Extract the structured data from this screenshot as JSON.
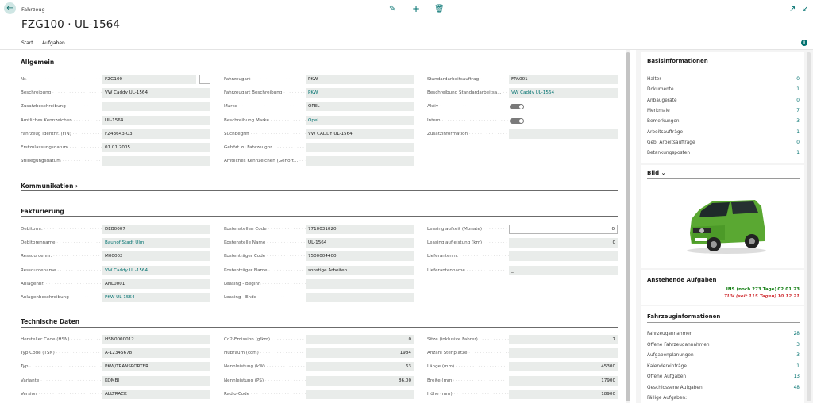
{
  "header": {
    "breadcrumb": "Fahrzeug",
    "title": "FZG100 · UL-1564",
    "icons": [
      "back-arrow-icon",
      "edit-icon",
      "plus-icon",
      "delete-icon",
      "open-new-icon",
      "collapse-icon"
    ]
  },
  "tabs": [
    "Start",
    "Aufgaben"
  ],
  "sections": {
    "allgemein": "Allgemein",
    "kommunikation": "Kommunikation",
    "fakturierung": "Fakturierung",
    "technische": "Technische Daten"
  },
  "allgemein": {
    "col1": [
      {
        "label": "Nr.",
        "value": "FZG100"
      },
      {
        "label": "Beschreibung",
        "value": "VW Caddy UL-1564"
      },
      {
        "label": "Zusatzbeschreibung",
        "value": ""
      },
      {
        "label": "Amtliches Kennzeichen",
        "value": "UL-1564"
      },
      {
        "label": "Fahrzeug Identnr. (FIN)",
        "value": "FZ43643-U3"
      },
      {
        "label": "Erstzulassungsdatum",
        "value": "01.01.2005"
      },
      {
        "label": "Stilllegungsdatum",
        "value": ""
      }
    ],
    "col2": [
      {
        "label": "Fahrzeugart",
        "value": "PKW"
      },
      {
        "label": "Fahrzeugart Beschreibung",
        "value": "PKW"
      },
      {
        "label": "Marke",
        "value": "OPEL"
      },
      {
        "label": "Beschreibung Marke",
        "value": "Opel"
      },
      {
        "label": "Suchbegriff",
        "value": "VW CADDY UL-1564"
      },
      {
        "label": "Gehört zu Fahrzeugnr.",
        "value": ""
      },
      {
        "label": "Amtliches Kennzeichen (Gehört...",
        "value": "_"
      }
    ],
    "col3": [
      {
        "label": "Standardarbeitsauftrag",
        "value": "FPA001"
      },
      {
        "label": "Beschreibung Standardarbeitsa...",
        "value": "VW Caddy UL-1564"
      },
      {
        "label": "Aktiv",
        "value": ""
      },
      {
        "label": "Intern",
        "value": ""
      },
      {
        "label": "Zusatzinformation",
        "value": ""
      }
    ],
    "more_button": "..."
  },
  "fakturierung": {
    "col1": [
      {
        "label": "Debitornr.",
        "value": "DEB0007"
      },
      {
        "label": "Debitorenname",
        "value": "Bauhof Stadt Ulm"
      },
      {
        "label": "Ressourcennr.",
        "value": "M00002"
      },
      {
        "label": "Ressourcename",
        "value": "VW Caddy UL-1564"
      },
      {
        "label": "Anlagennr.",
        "value": "ANL0001"
      },
      {
        "label": "Anlagenbeschreibung",
        "value": "PKW UL-1564"
      }
    ],
    "col2": [
      {
        "label": "Kostenstellen Code",
        "value": "7710031020"
      },
      {
        "label": "Kostenstelle Name",
        "value": "UL-1564"
      },
      {
        "label": "Kostenträger Code",
        "value": "7500004400"
      },
      {
        "label": "Kostenträger Name",
        "value": "sonstige Arbeiten"
      },
      {
        "label": "Leasing - Beginn",
        "value": ""
      },
      {
        "label": "Leasing - Ende",
        "value": ""
      }
    ],
    "col3": [
      {
        "label": "Leasinglaufzeit (Monate)",
        "value": "0"
      },
      {
        "label": "Leasinglaufleistung (km)",
        "value": "0"
      },
      {
        "label": "Lieferantennr.",
        "value": ""
      },
      {
        "label": "Lieferantenname",
        "value": "_"
      }
    ]
  },
  "technische": {
    "col1": [
      {
        "label": "Hersteller Code (HSN)",
        "value": "HSN0000012"
      },
      {
        "label": "Typ Code (TSN)",
        "value": "A-12345678"
      },
      {
        "label": "Typ",
        "value": "PKW/TRANSPORTER"
      },
      {
        "label": "Variante",
        "value": "KOMBI"
      },
      {
        "label": "Version",
        "value": "ALLTRACK"
      }
    ],
    "col2": [
      {
        "label": "Co2-Emission (g/km)",
        "value": "0"
      },
      {
        "label": "Hubraum (ccm)",
        "value": "1984"
      },
      {
        "label": "Nennleistung (kW)",
        "value": "63"
      },
      {
        "label": "Nennleistung (PS)",
        "value": "86,00"
      },
      {
        "label": "Radio-Code",
        "value": ""
      }
    ],
    "col3": [
      {
        "label": "Sitze (inklusive Fahrer)",
        "value": "7"
      },
      {
        "label": "Anzahl Stehplätze",
        "value": ""
      },
      {
        "label": "Länge (mm)",
        "value": "45300"
      },
      {
        "label": "Breite (mm)",
        "value": "17900"
      },
      {
        "label": "Höhe (mm)",
        "value": "18900"
      }
    ]
  },
  "sidebar": {
    "basis_title": "Basisinformationen",
    "basis": [
      {
        "label": "Halter",
        "value": "0"
      },
      {
        "label": "Dokumente",
        "value": "1"
      },
      {
        "label": "Anbaugeräte",
        "value": "0"
      },
      {
        "label": "Merkmale",
        "value": "7"
      },
      {
        "label": "Bemerkungen",
        "value": "3"
      },
      {
        "label": "Arbeitsaufträge",
        "value": "1"
      },
      {
        "label": "Geb. Arbeitsaufträge",
        "value": "0"
      },
      {
        "label": "Betankungsposten",
        "value": "1"
      }
    ],
    "bild_title": "Bild",
    "tasks_title": "Anstehende Aufgaben",
    "tasks": [
      {
        "text": "INS (noch 273 Tage)",
        "date": "02.01.23",
        "color": "#107c10"
      },
      {
        "text": "TÜV (seit 115 Tagen)",
        "date": "10.12.21",
        "color": "#d13438"
      }
    ],
    "fz_title": "Fahrzeuginformationen",
    "fz": [
      {
        "label": "Fahrzeugannahmen",
        "value": "28"
      },
      {
        "label": "Offene Fahrzeugannahmen",
        "value": "3"
      },
      {
        "label": "Aufgabenplanungen",
        "value": "3"
      },
      {
        "label": "Kalendereinträge",
        "value": "1"
      },
      {
        "label": "Offene Aufgaben",
        "value": "13"
      },
      {
        "label": "Geschlossene Aufgaben",
        "value": "48"
      },
      {
        "label": "Fällige Aufgaben:",
        "value": ""
      }
    ]
  }
}
